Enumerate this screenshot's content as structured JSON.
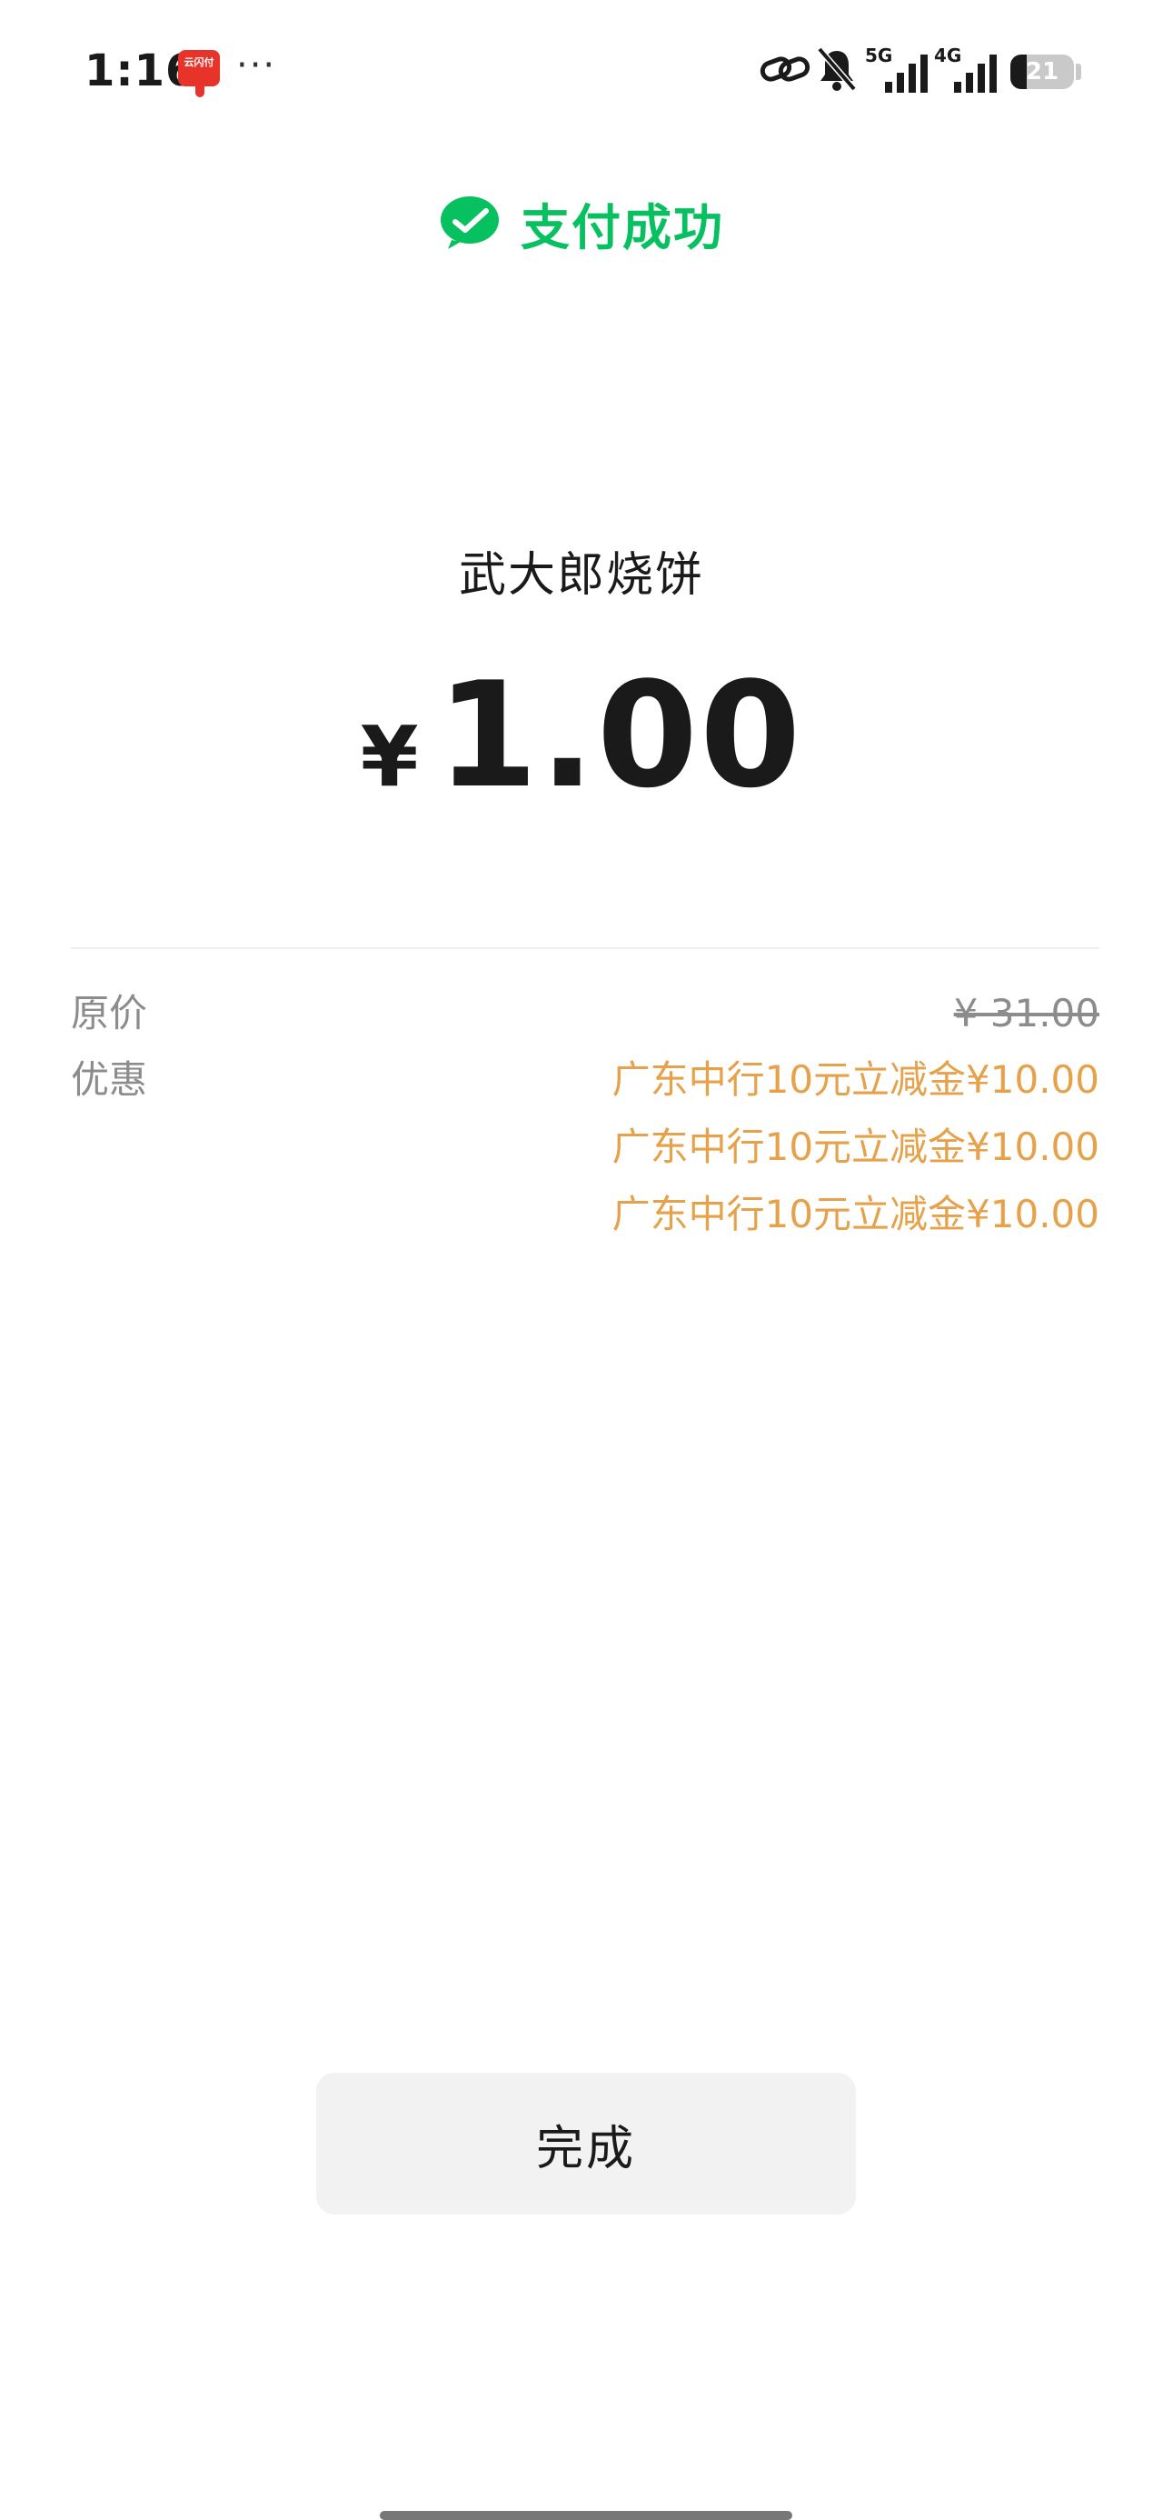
{
  "status_bar": {
    "time": "1:16",
    "app_notification_label": "云闪付",
    "more": "···",
    "network_1": "5G",
    "network_2": "4G",
    "battery_level": "21"
  },
  "header": {
    "title": "支付成功",
    "accent_color": "#07c160"
  },
  "payment": {
    "merchant": "武大郎烧饼",
    "currency_symbol": "¥",
    "amount": "1.00"
  },
  "details": {
    "original_price_label": "原价",
    "original_price": "¥ 31.00",
    "discount_label": "优惠",
    "discounts": [
      "广东中行10元立减金¥10.00",
      "广东中行10元立减金¥10.00",
      "广东中行10元立减金¥10.00"
    ],
    "discount_color": "#e5a24a"
  },
  "actions": {
    "done_label": "完成"
  }
}
